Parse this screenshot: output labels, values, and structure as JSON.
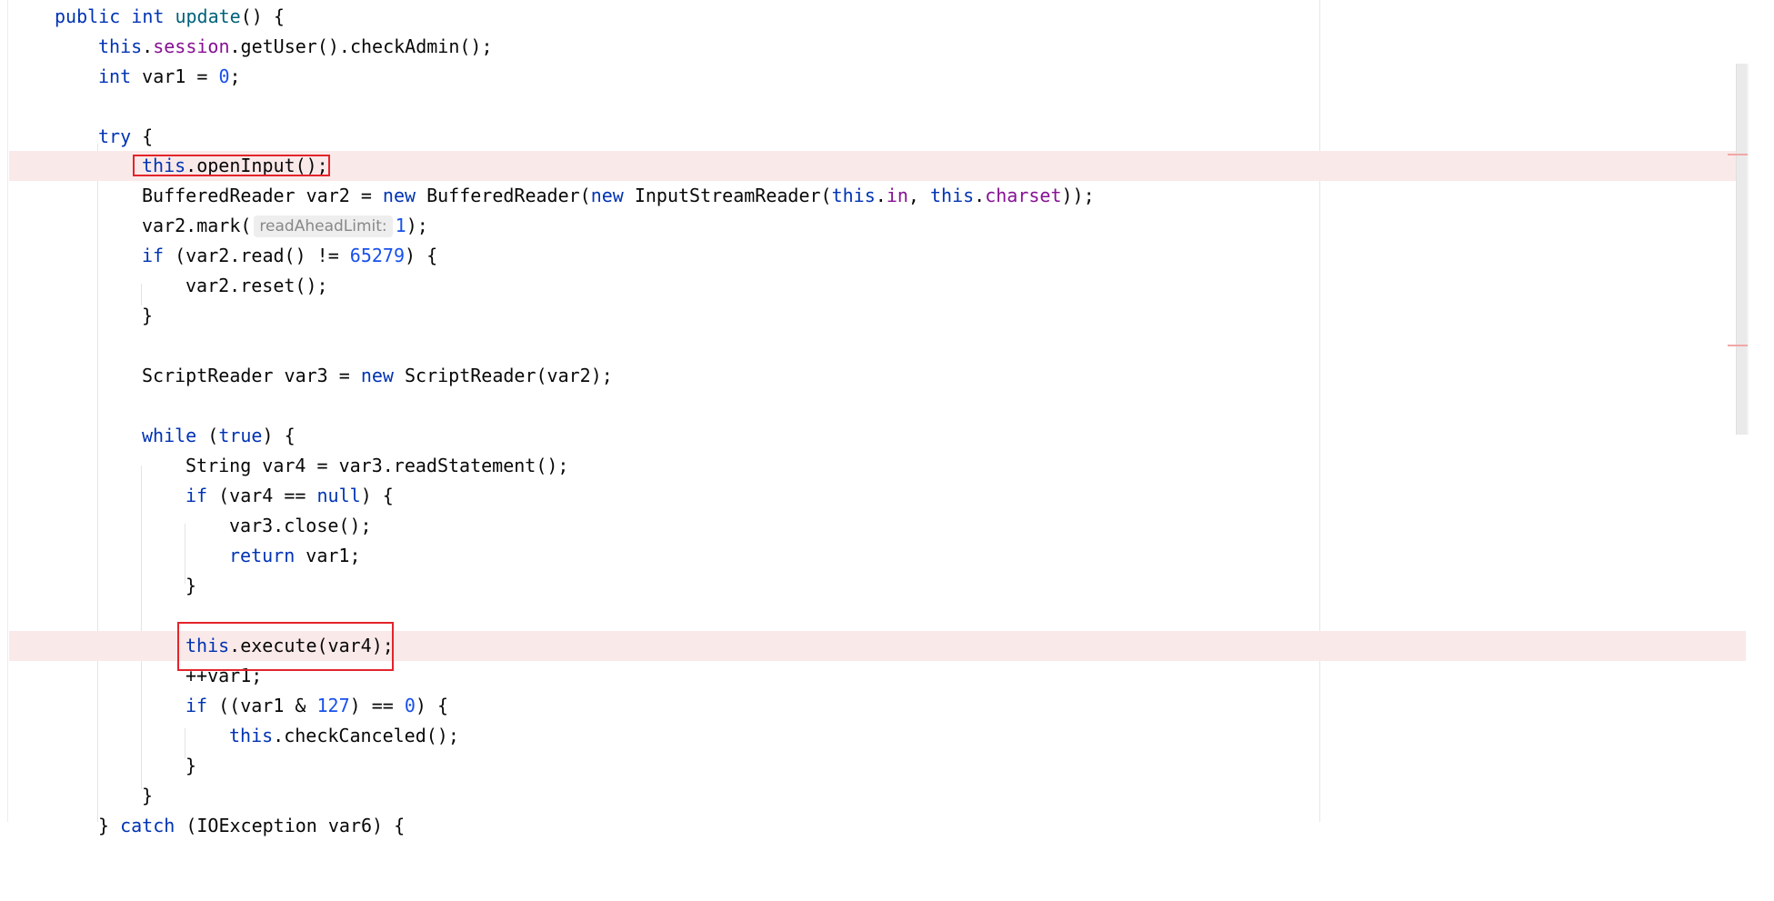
{
  "editor": {
    "code": {
      "l1": [
        "public int ",
        "update",
        "() {"
      ],
      "l2": [
        "this",
        ".",
        "session",
        ".getUser().checkAdmin();"
      ],
      "l3": [
        "int ",
        "var1 = ",
        "0",
        ";"
      ],
      "l5": [
        "try",
        " {"
      ],
      "l6": [
        "this",
        ".openInput();"
      ],
      "l7": [
        "BufferedReader var2 = ",
        "new",
        " BufferedReader(",
        "new",
        " InputStreamReader(",
        "this",
        ".",
        "in",
        ", ",
        "this",
        ".",
        "charset",
        "));"
      ],
      "l8": [
        "var2.mark(",
        "readAheadLimit:",
        "1",
        ");"
      ],
      "l9": [
        "if",
        " (var2.read() != ",
        "65279",
        ") {"
      ],
      "l10": [
        "var2.reset();"
      ],
      "l11": [
        "}"
      ],
      "l13": [
        "ScriptReader var3 = ",
        "new",
        " ScriptReader(var2);"
      ],
      "l15": [
        "while",
        " (",
        "true",
        ") {"
      ],
      "l16": [
        "String var4 = var3.readStatement();"
      ],
      "l17": [
        "if",
        " (var4 == ",
        "null",
        ") {"
      ],
      "l18": [
        "var3.close();"
      ],
      "l19": [
        "return",
        " var1;"
      ],
      "l20": [
        "}"
      ],
      "l22": [
        "this",
        ".execute(var4);"
      ],
      "l23": [
        "++var1;"
      ],
      "l24": [
        "if",
        " ((var1 & ",
        "127",
        ") == ",
        "0",
        ") {"
      ],
      "l25": [
        "this",
        ".checkCanceled();"
      ],
      "l26": [
        "}"
      ],
      "l27": [
        "}"
      ],
      "l28": [
        "} ",
        "catch",
        " (IOException var6) {"
      ]
    }
  },
  "colors": {
    "keyword": "#0033b3",
    "field": "#871094",
    "number": "#1750eb",
    "highlight_line": "#fae9e9",
    "annotation_box": "#e3242b"
  }
}
